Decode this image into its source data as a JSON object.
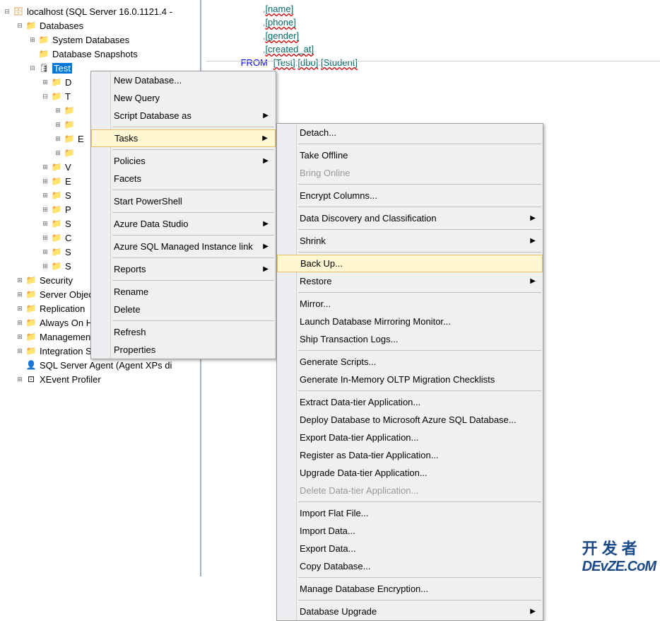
{
  "tree": {
    "server": "localhost (SQL Server 16.0.1121.4 -",
    "databases": "Databases",
    "sysdb": "System Databases",
    "snapshots": "Database Snapshots",
    "test": "Test",
    "partials": [
      "D",
      "T",
      "",
      "",
      "E",
      "",
      "V",
      "E",
      "S",
      "P",
      "S",
      "C",
      "S",
      "S"
    ],
    "security": "Security",
    "serverobj": "Server Objects",
    "replication": "Replication",
    "alwayson": "Always On High Availability",
    "management": "Management",
    "iscatalogs": "Integration Services Catalogs",
    "sqlagent": "SQL Server Agent (Agent XPs di",
    "xevent": "XEvent Profiler"
  },
  "sql": {
    "l1": ",[name]",
    "l2": ",[phone]",
    "l3": ",[gender]",
    "l4": ",[created_at]",
    "from": "FROM",
    "l5a": "[Test]",
    "l5b": "[dbo]",
    "l5c": "[Student]"
  },
  "menu1": [
    {
      "label": "New Database...",
      "arrow": false
    },
    {
      "label": "New Query",
      "arrow": false
    },
    {
      "label": "Script Database as",
      "arrow": true
    },
    {
      "sep": true
    },
    {
      "label": "Tasks",
      "arrow": true,
      "highlighted": true
    },
    {
      "sep": true
    },
    {
      "label": "Policies",
      "arrow": true
    },
    {
      "label": "Facets",
      "arrow": false
    },
    {
      "sep": true
    },
    {
      "label": "Start PowerShell",
      "arrow": false
    },
    {
      "sep": true
    },
    {
      "label": "Azure Data Studio",
      "arrow": true
    },
    {
      "sep": true
    },
    {
      "label": "Azure SQL Managed Instance link",
      "arrow": true
    },
    {
      "sep": true
    },
    {
      "label": "Reports",
      "arrow": true
    },
    {
      "sep": true
    },
    {
      "label": "Rename",
      "arrow": false
    },
    {
      "label": "Delete",
      "arrow": false
    },
    {
      "sep": true
    },
    {
      "label": "Refresh",
      "arrow": false
    },
    {
      "label": "Properties",
      "arrow": false
    }
  ],
  "menu2": [
    {
      "label": "Detach...",
      "arrow": false
    },
    {
      "sep": true
    },
    {
      "label": "Take Offline",
      "arrow": false
    },
    {
      "label": "Bring Online",
      "arrow": false,
      "disabled": true
    },
    {
      "sep": true
    },
    {
      "label": "Encrypt Columns...",
      "arrow": false
    },
    {
      "sep": true
    },
    {
      "label": "Data Discovery and Classification",
      "arrow": true
    },
    {
      "sep": true
    },
    {
      "label": "Shrink",
      "arrow": true
    },
    {
      "sep": true
    },
    {
      "label": "Back Up...",
      "arrow": false,
      "highlighted": true
    },
    {
      "label": "Restore",
      "arrow": true
    },
    {
      "sep": true
    },
    {
      "label": "Mirror...",
      "arrow": false
    },
    {
      "label": "Launch Database Mirroring Monitor...",
      "arrow": false
    },
    {
      "label": "Ship Transaction Logs...",
      "arrow": false
    },
    {
      "sep": true
    },
    {
      "label": "Generate Scripts...",
      "arrow": false
    },
    {
      "label": "Generate In-Memory OLTP Migration Checklists",
      "arrow": false
    },
    {
      "sep": true
    },
    {
      "label": "Extract Data-tier Application...",
      "arrow": false
    },
    {
      "label": "Deploy Database to Microsoft Azure SQL Database...",
      "arrow": false
    },
    {
      "label": "Export Data-tier Application...",
      "arrow": false
    },
    {
      "label": "Register as Data-tier Application...",
      "arrow": false
    },
    {
      "label": "Upgrade Data-tier Application...",
      "arrow": false
    },
    {
      "label": "Delete Data-tier Application...",
      "arrow": false,
      "disabled": true
    },
    {
      "sep": true
    },
    {
      "label": "Import Flat File...",
      "arrow": false
    },
    {
      "label": "Import Data...",
      "arrow": false
    },
    {
      "label": "Export Data...",
      "arrow": false
    },
    {
      "label": "Copy Database...",
      "arrow": false
    },
    {
      "sep": true
    },
    {
      "label": "Manage Database Encryption...",
      "arrow": false
    },
    {
      "sep": true
    },
    {
      "label": "Database Upgrade",
      "arrow": true
    }
  ],
  "watermark": {
    "cn": "开发者",
    "en": "DEvZE.CoM"
  }
}
